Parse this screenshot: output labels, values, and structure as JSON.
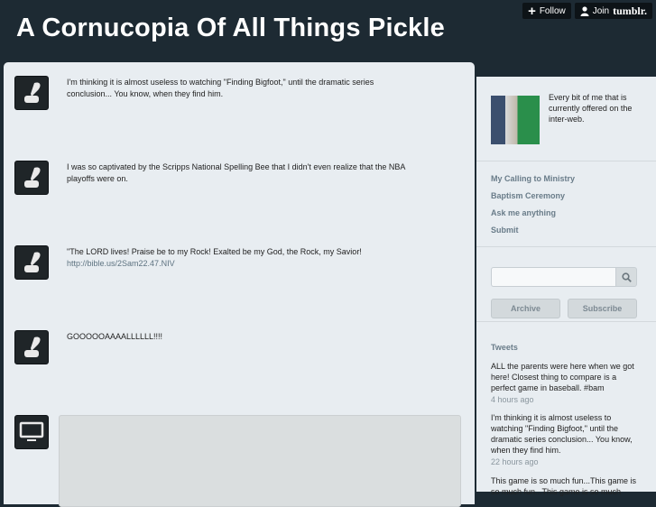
{
  "topbar": {
    "follow_label": "Follow",
    "join_label": "Join",
    "tumblr_label": "tumblr."
  },
  "site": {
    "title": "A Cornucopia Of All Things Pickle"
  },
  "posts": [
    {
      "text": "I'm thinking it is almost useless to watching \"Finding Bigfoot,\" until the dramatic series conclusion... You know, when they find him.",
      "icon": "quill-ink-icon"
    },
    {
      "text": "I was so captivated by the Scripps National Spelling Bee that I didn't even realize that the NBA playoffs were on.",
      "icon": "quill-ink-icon"
    },
    {
      "text": "\"The LORD lives! Praise be to my Rock! Exalted be my God, the Rock, my Savior!",
      "link": "http://bible.us/2Sam22.47.NIV",
      "icon": "quill-ink-icon"
    },
    {
      "text": "GOOOOOAAAALLLLLL!!!!",
      "icon": "quill-ink-icon"
    },
    {
      "icon": "monitor-icon"
    }
  ],
  "sidebar": {
    "description": "Every bit of me that is currently offered on the inter-web.",
    "links": [
      "My Calling to Ministry",
      "Baptism Ceremony",
      "Ask me anything",
      "Submit"
    ],
    "search_placeholder": "",
    "archive_label": "Archive",
    "subscribe_label": "Subscribe",
    "tweets_title": "Tweets",
    "tweets": [
      {
        "text": "ALL the parents were here when we got here! Closest thing to compare is a perfect game in baseball. #bam",
        "time": "4 hours ago"
      },
      {
        "text": "I'm thinking it is almost useless to watching \"Finding Bigfoot,\" until the dramatic series conclusion... You know, when they find him.",
        "time": "22 hours ago"
      },
      {
        "text": "This game is so much fun...This game is so much fun...This game is so much",
        "time": ""
      }
    ]
  },
  "colors": {
    "background": "#1d2a33",
    "panel": "#e8edf1",
    "link": "#697c89"
  }
}
